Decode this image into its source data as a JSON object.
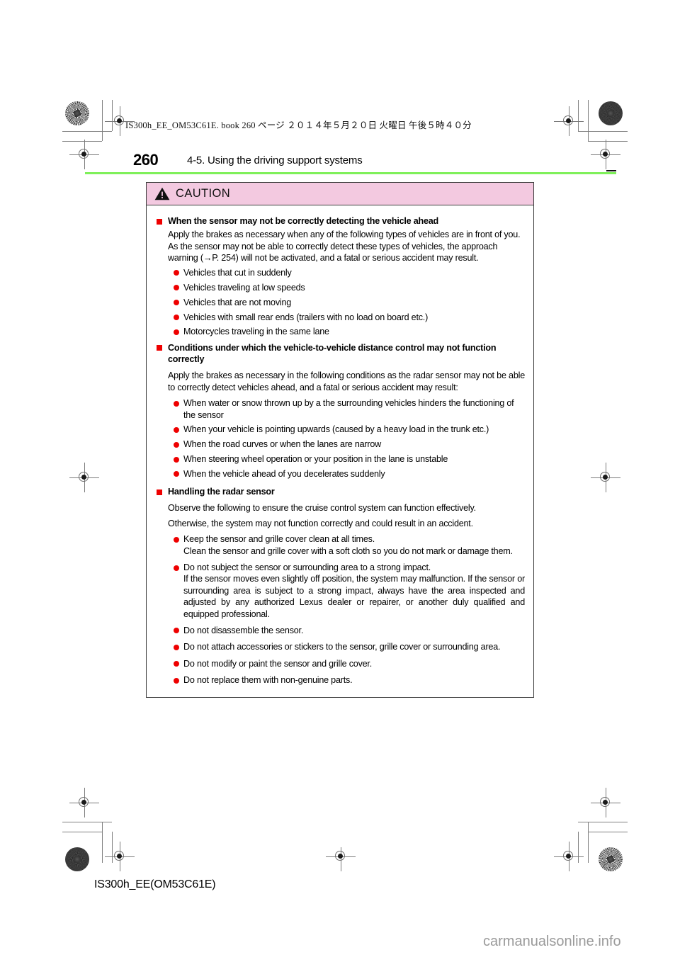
{
  "page": {
    "file_header": "IS300h_EE_OM53C61E. book   260 ページ   ２０１４年５月２０日   火曜日   午後５時４０分",
    "page_number": "260",
    "section_title": "4-5. Using the driving support systems",
    "footer_code": "IS300h_EE(OM53C61E)",
    "watermark": "carmanualsonline.info"
  },
  "colors": {
    "caution_header_bg": "#f3c9e0",
    "bullet_red": "#ee0000",
    "rule_green": "#7ff05a",
    "box_border": "#3c3c3c",
    "watermark_gray": "#9a9a9a"
  },
  "caution": {
    "label": "CAUTION",
    "icon": "warning-triangle-icon",
    "sections": [
      {
        "heading": "When the sensor may not be correctly detecting the vehicle ahead",
        "paragraphs": [
          "Apply the brakes as necessary when any of the following types of vehicles are in front of you.",
          "As the sensor may not be able to correctly detect these types of vehicles, the approach warning (→P. 254) will not be activated, and a fatal or serious accident may result."
        ],
        "bullets": [
          {
            "text": "Vehicles that cut in suddenly"
          },
          {
            "text": "Vehicles traveling at low speeds"
          },
          {
            "text": "Vehicles that are not moving"
          },
          {
            "text": "Vehicles with small rear ends (trailers with no load on board etc.)"
          },
          {
            "text": "Motorcycles traveling in the same lane"
          }
        ]
      },
      {
        "heading": "Conditions under which the vehicle-to-vehicle distance control may not function correctly",
        "paragraphs": [
          "Apply the brakes as necessary in the following conditions as the radar sensor may not be able to correctly detect vehicles ahead, and a fatal or serious accident may result:"
        ],
        "bullets": [
          {
            "text": "When water or snow thrown up by a the surrounding vehicles hinders the functioning of the sensor"
          },
          {
            "text": "When your vehicle is pointing upwards (caused by a heavy load in the trunk etc.)"
          },
          {
            "text": "When the road curves or when the lanes are narrow"
          },
          {
            "text": "When steering wheel operation or your position in the lane is unstable"
          },
          {
            "text": "When the vehicle ahead of you decelerates suddenly"
          }
        ]
      },
      {
        "heading": "Handling the radar sensor",
        "paragraphs": [
          "Observe the following to ensure the cruise control system can function effectively.",
          "Otherwise, the system may not function correctly and could result in an accident."
        ],
        "bullets": [
          {
            "text": "Keep the sensor and grille cover clean at all times.",
            "sub": "Clean the sensor and grille cover with a soft cloth so you do not mark or damage them."
          },
          {
            "text": "Do not subject the sensor or surrounding area to a strong impact.",
            "sub": "If the sensor moves even slightly off position, the system may malfunction. If the sensor or surrounding area is subject to a strong impact, always have the area inspected and adjusted by any authorized Lexus dealer or repairer, or another duly qualified and equipped professional."
          },
          {
            "text": "Do not disassemble the sensor."
          },
          {
            "text": "Do not attach accessories or stickers to the sensor, grille cover or surrounding area."
          },
          {
            "text": "Do not modify or paint the sensor and grille cover."
          },
          {
            "text": "Do not replace them with non-genuine parts."
          }
        ]
      }
    ]
  }
}
